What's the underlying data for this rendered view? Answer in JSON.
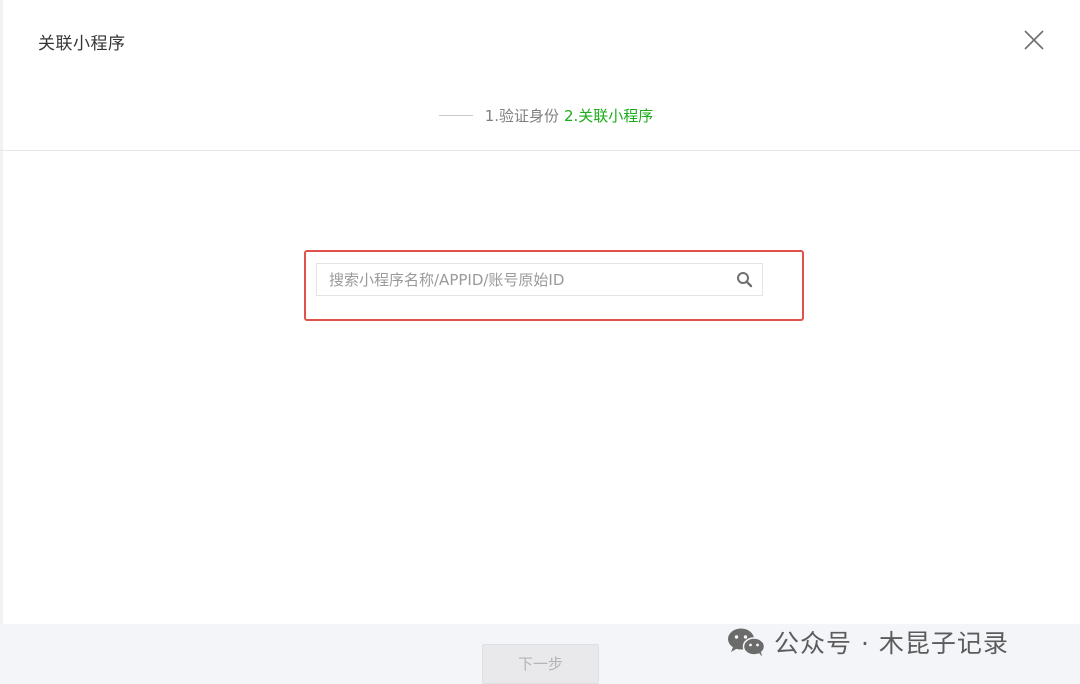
{
  "dialog": {
    "title": "关联小程序",
    "close_icon": "close-icon"
  },
  "steps": {
    "step1": "1.验证身份",
    "step2": "2.关联小程序",
    "active_color": "#1aad19"
  },
  "search": {
    "placeholder": "搜索小程序名称/APPID/账号原始ID",
    "value": "",
    "icon": "search-icon",
    "highlight_color": "#e0524a"
  },
  "footer": {
    "next_label": "下一步"
  },
  "watermark": {
    "text": "公众号 · 木昆子记录",
    "icon": "wechat-icon"
  }
}
